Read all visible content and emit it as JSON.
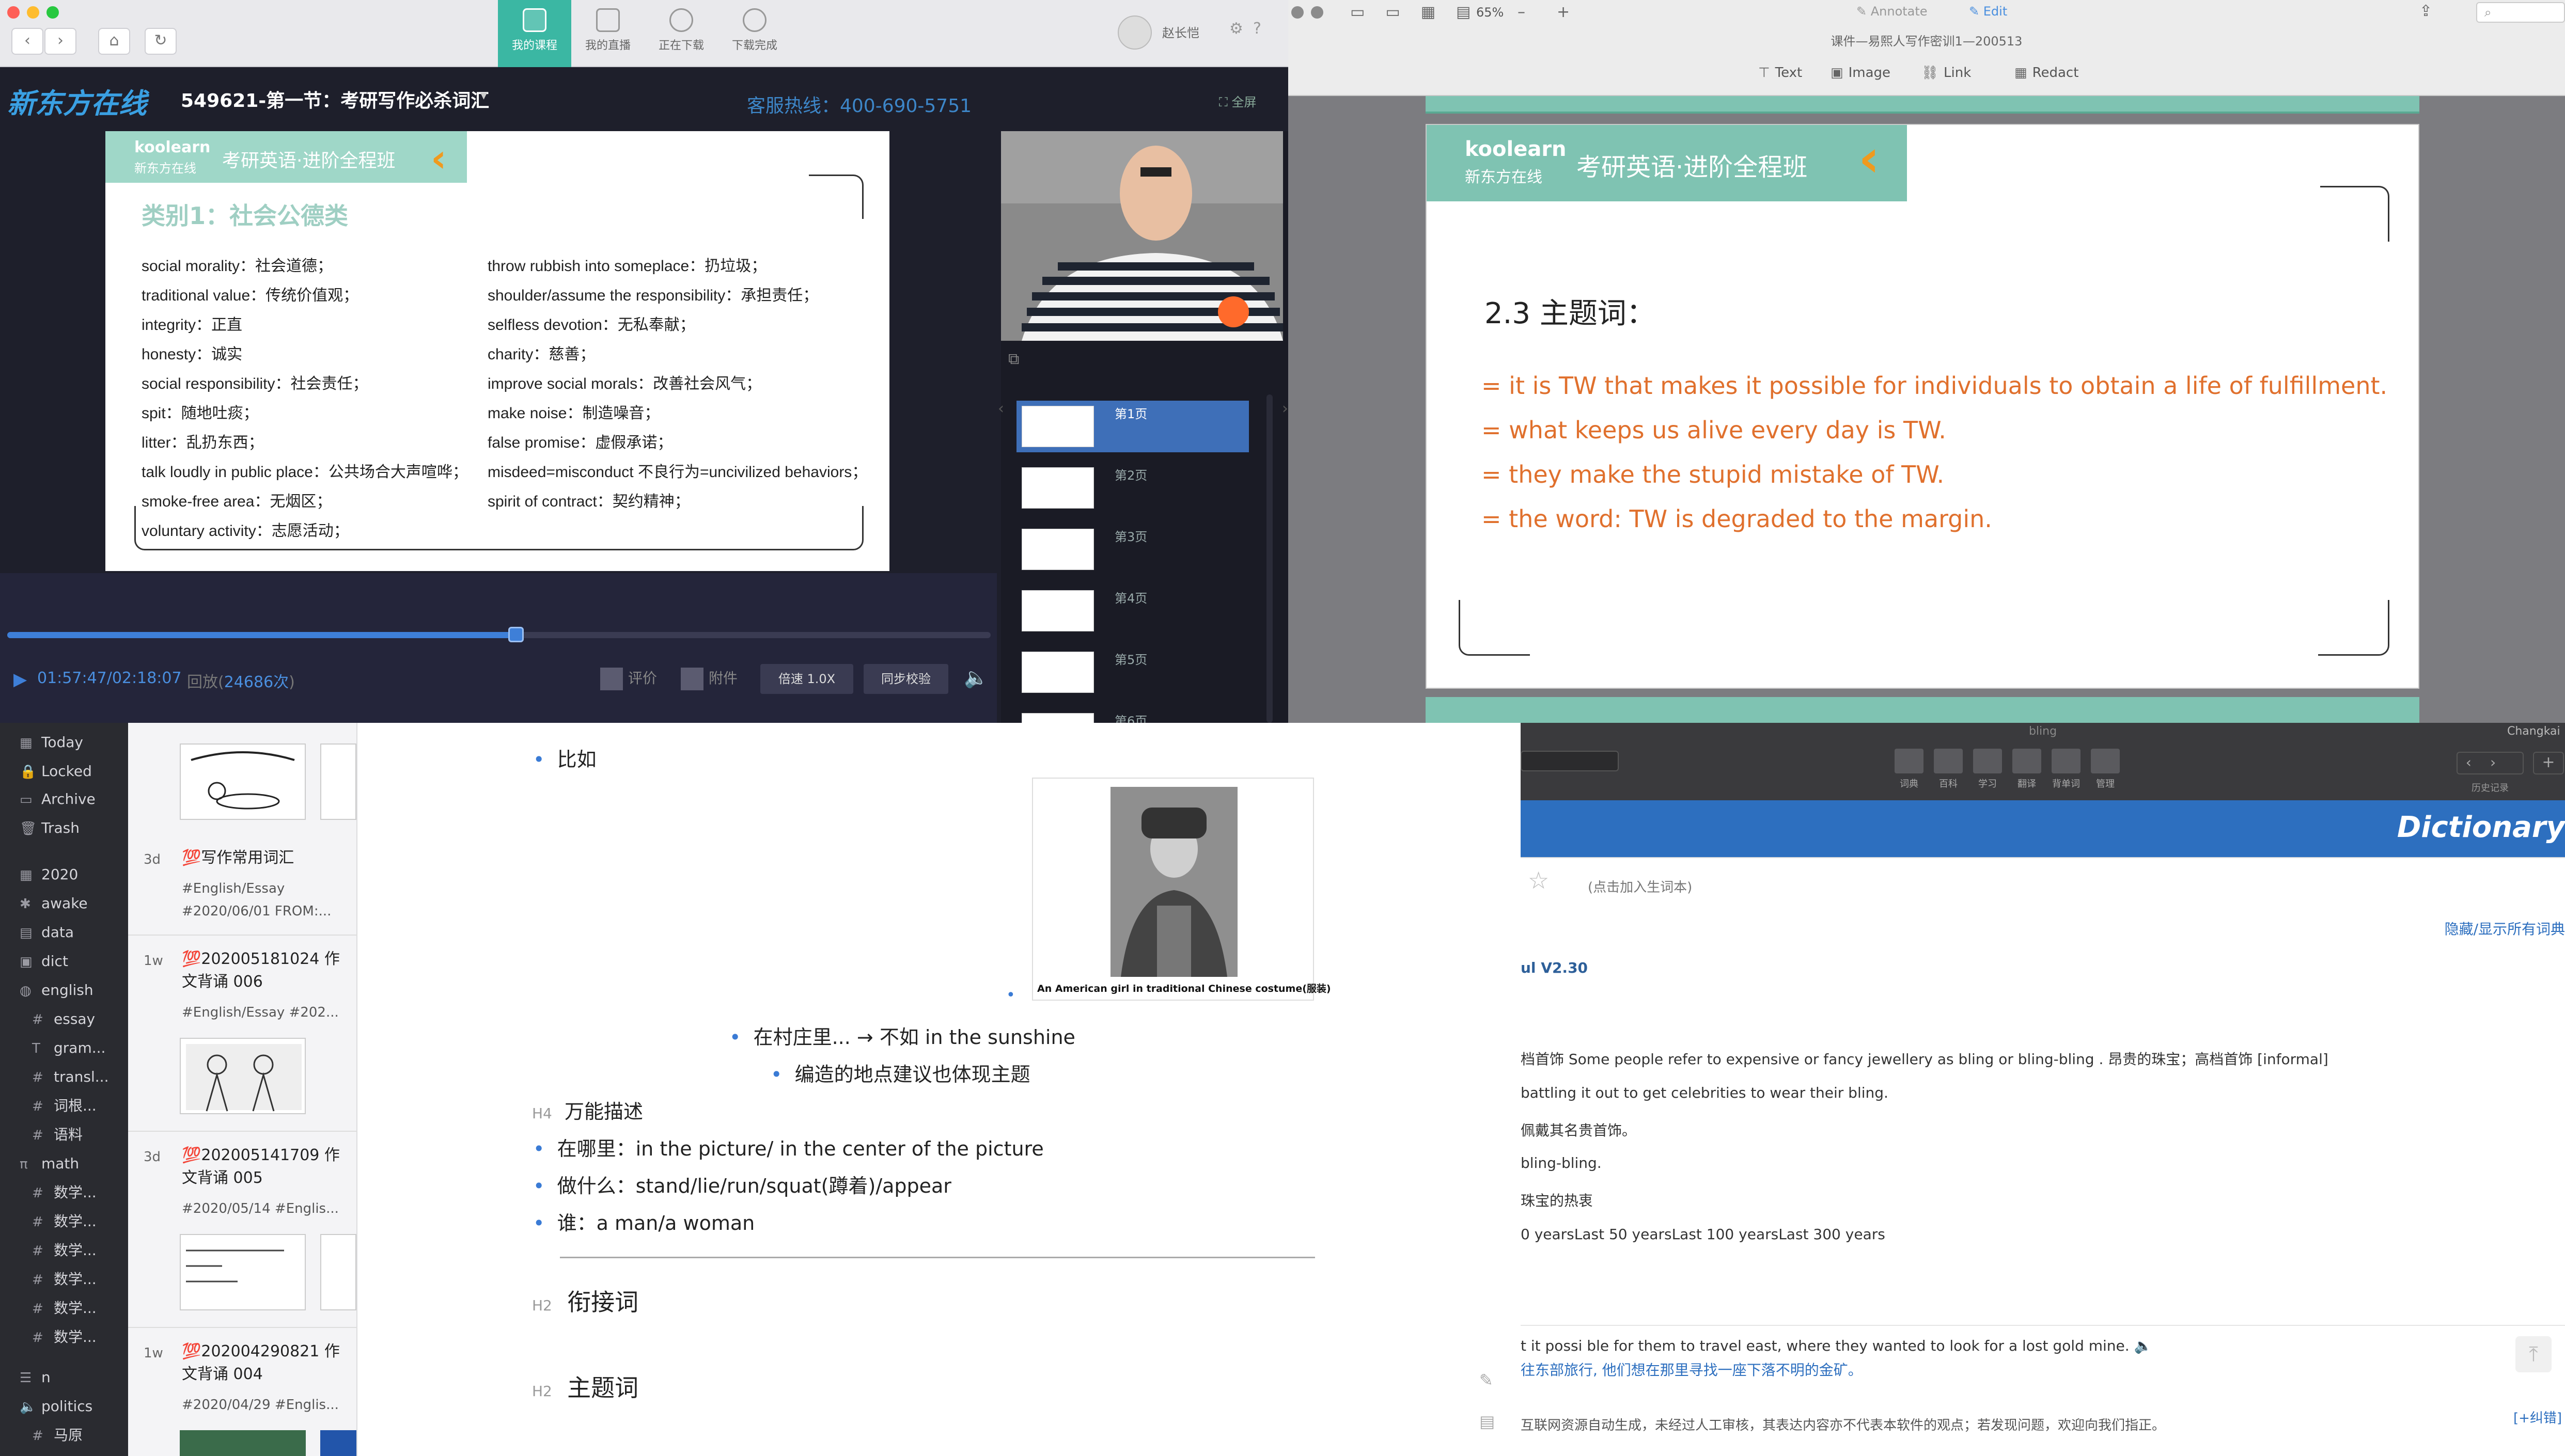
{
  "video_window": {
    "tabs": [
      {
        "label": "我的课程",
        "active": true
      },
      {
        "label": "我的直播",
        "active": false
      },
      {
        "label": "正在下载",
        "active": false
      },
      {
        "label": "下载完成",
        "active": false
      }
    ],
    "user_name": "赵长恺",
    "logo": "新东方在线",
    "course_title": "549621-第一节：考研写作必杀词汇",
    "hotline": "客服热线：400-690-5751",
    "fullscreen_label": "全屏",
    "slide": {
      "brand": "koolearn",
      "brand_sub": "新东方在线",
      "banner_title": "考研英语·进阶全程班",
      "category": "类别1：社会公德类",
      "left_items": [
        "social morality：社会道德；",
        "traditional value：传统价值观；",
        "integrity：正直",
        "honesty：诚实",
        "social responsibility：社会责任；",
        "spit：随地吐痰；",
        "litter：乱扔东西；",
        "talk loudly in public place：公共场合大声喧哗；",
        "smoke-free area：无烟区；",
        "voluntary activity：志愿活动；"
      ],
      "right_items": [
        "throw rubbish into someplace：扔垃圾；",
        "shoulder/assume the responsibility：承担责任；",
        "selfless devotion：无私奉献；",
        "charity：慈善；",
        "improve social morals：改善社会风气；",
        "make noise：制造噪音；",
        "false promise：虚假承诺；",
        "misdeed=misconduct 不良行为=uncivilized behaviors；",
        "spirit of contract：契约精神；"
      ]
    },
    "thumbnails": [
      "第1页",
      "第2页",
      "第3页",
      "第4页",
      "第5页",
      "第6页"
    ],
    "active_thumbnail": 0,
    "time": "01:57:47/02:18:07",
    "replay_label": "回放(",
    "replay_count": "24686次",
    "replay_close": ")",
    "progress_fraction": 0.84,
    "buffer_from": 0.45,
    "buffer_to": 0.51,
    "rate_label": "评价",
    "attach_label": "附件",
    "speed_label": "倍速",
    "speed_value": "1.0X",
    "sync_label": "同步校验"
  },
  "pdf_window": {
    "zoom": "65%",
    "annotate": "Annotate",
    "edit": "Edit",
    "filename": "课件—易熙人写作密训1—200513",
    "tools": [
      "Text",
      "Image",
      "Link",
      "Redact"
    ],
    "brand": "koolearn",
    "brand_sub": "新东方在线",
    "banner_title": "考研英语·进阶全程班",
    "heading": "2.3 主题词：",
    "lines": [
      "= it is TW that makes it possible for individuals to obtain a life of fulfillment.",
      "= what keeps us alive every day is TW.",
      "= they make the stupid mistake of TW.",
      "= the word: TW is degraded to the margin."
    ]
  },
  "notes_window": {
    "sidebar": [
      {
        "label": "Today",
        "icon": "calendar-icon"
      },
      {
        "label": "Locked",
        "icon": "lock-icon"
      },
      {
        "label": "Archive",
        "icon": "archive-icon"
      },
      {
        "label": "Trash",
        "icon": "trash-icon"
      },
      {
        "label": "2020",
        "icon": "calendar-icon"
      },
      {
        "label": "awake",
        "icon": "sparkle-icon"
      },
      {
        "label": "data",
        "icon": "database-icon"
      },
      {
        "label": "dict",
        "icon": "book-icon"
      },
      {
        "label": "english",
        "icon": "globe-icon"
      },
      {
        "label": "essay",
        "icon": "hash-icon"
      },
      {
        "label": "gram...",
        "icon": "text-icon"
      },
      {
        "label": "transl...",
        "icon": "hash-icon"
      },
      {
        "label": "词根...",
        "icon": "hash-icon"
      },
      {
        "label": "语料",
        "icon": "hash-icon"
      },
      {
        "label": "math",
        "icon": "pi-icon"
      },
      {
        "label": "数学...",
        "icon": "hash-icon"
      },
      {
        "label": "数学...",
        "icon": "hash-icon"
      },
      {
        "label": "数学...",
        "icon": "hash-icon"
      },
      {
        "label": "数学...",
        "icon": "hash-icon"
      },
      {
        "label": "数学...",
        "icon": "hash-icon"
      },
      {
        "label": "数学...",
        "icon": "hash-icon"
      },
      {
        "label": "n",
        "icon": "list-icon"
      },
      {
        "label": "politics",
        "icon": "speaker-icon"
      },
      {
        "label": "马原",
        "icon": "hash-icon"
      }
    ],
    "notes": [
      {
        "time": "3d",
        "title": "💯写作常用词汇",
        "tags": "#English/Essay",
        "tags2": "#2020/06/01 FROM:..."
      },
      {
        "time": "1w",
        "title": "💯202005181024 作文背诵 006",
        "tags": "#English/Essay #202..."
      },
      {
        "time": "3d",
        "title": "💯202005141709 作文背诵 005",
        "tags": "#2020/05/14 #Englis..."
      },
      {
        "time": "1w",
        "title": "💯202004290821 作文背诵 004",
        "tags": "#2020/04/29 #Englis..."
      }
    ],
    "editor": {
      "bullet_top": "比如",
      "image_caption": "An American girl in traditional Chinese costume(服装)",
      "sub1": "在村庄里... → 不如 in the sunshine",
      "sub2": "编造的地点建议也体现主题",
      "h4_mark": "H4",
      "h4": "万能描述",
      "items": [
        "在哪里：in the picture/ in the center of the picture",
        "做什么：stand/lie/run/squat(蹲着)/appear",
        "谁：a man/a woman"
      ],
      "h2_mark": "H2",
      "h2a": "衔接词",
      "h2b": "主题词"
    }
  },
  "dict_window": {
    "window_title": "bling",
    "user": "Changkai",
    "tool_labels": [
      "词典",
      "百科",
      "学习",
      "翻译",
      "背单词",
      "管理"
    ],
    "history_label": "历史记录",
    "banner": "Dictionary",
    "add_wordbook": "(点击加入生词本)",
    "toggle_all": "隐藏/显示所有词典",
    "version": "ul V2.30",
    "lines": [
      "档首饰 Some people refer to expensive or fancy jewellery as bling or bling-bling . 昂贵的珠宝；高档首饰 [informal]",
      "battling it out to get celebrities to wear their bling.",
      "佩戴其名贵首饰。",
      "bling-bling.",
      "珠宝的热衷",
      "0 yearsLast 50 yearsLast 100 yearsLast 300 years"
    ],
    "example_en": "t it possi ble for them to travel east, where they wanted to look for a lost gold mine.",
    "example_zh": "往东部旅行, 他们想在那里寻找一座下落不明的金矿。",
    "disclaimer": "互联网资源自动生成，未经过人工审核，其表达内容亦不代表本软件的观点；若发现问题，欢迎向我们指正。",
    "correct": "[+纠错]"
  }
}
